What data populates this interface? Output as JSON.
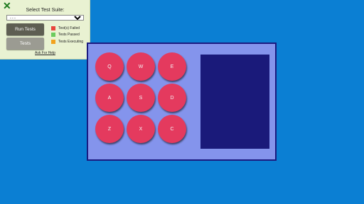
{
  "panel": {
    "close_glyph": "✕",
    "title": "Select Test Suite:",
    "suite_select_value": "- - -",
    "run_button": "Run Tests",
    "tests_button": "Tests",
    "legend": [
      {
        "label": "Test(s) Failed",
        "color": "#e8453c"
      },
      {
        "label": "Tests Passed",
        "color": "#6ccb5f"
      },
      {
        "label": "Tests Executing",
        "color": "#f2a21d"
      }
    ],
    "help_link": "Ask For Help"
  },
  "keyboard": {
    "keys": [
      "Q",
      "W",
      "E",
      "A",
      "S",
      "D",
      "Z",
      "X",
      "C"
    ],
    "key_color": "#e43a5e",
    "board_color": "#8494ec",
    "screen_color": "#1a1a7a",
    "background_color": "#0b7fd3"
  }
}
